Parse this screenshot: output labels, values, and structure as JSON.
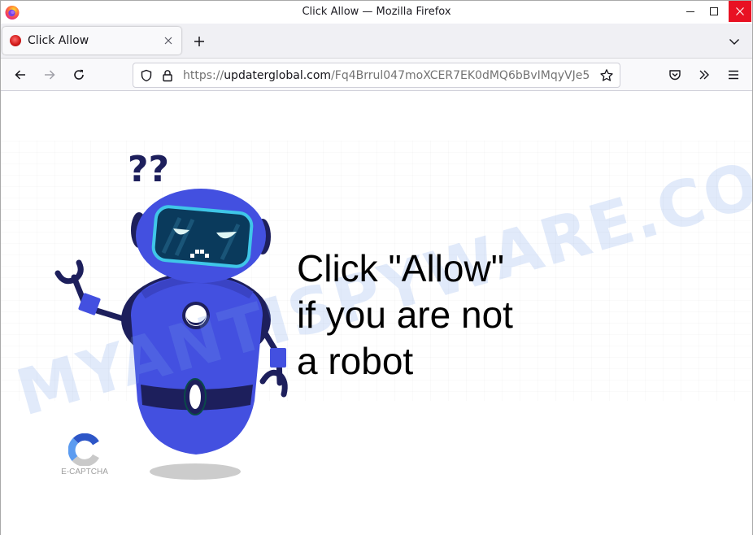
{
  "window": {
    "title": "Click Allow — Mozilla Firefox",
    "controls": {
      "minimize": "minimize",
      "maximize": "maximize",
      "close": "close"
    },
    "close_color": "#e81123"
  },
  "tabs": [
    {
      "label": "Click Allow",
      "active": true,
      "favicon": "red-circle-favicon"
    }
  ],
  "tabstrip": {
    "new_tab_icon": "plus-icon",
    "list_tabs_icon": "chevron-down-icon"
  },
  "navbar": {
    "back_icon": "arrow-left-icon",
    "forward_icon": "arrow-right-icon",
    "reload_icon": "reload-icon",
    "url": {
      "scheme": "https://",
      "host": "updaterglobal.com",
      "path": "/Fq4Brrul047moXCER7EK0dMQ6bBvIMqyVJe5"
    },
    "bookmark_icon": "star-icon",
    "pocket_icon": "pocket-icon",
    "overflow_icon": "double-chevron-right-icon",
    "menu_icon": "hamburger-menu-icon"
  },
  "page": {
    "message_lines": [
      "Click \"Allow\"",
      "if you are not",
      "a robot"
    ],
    "captcha_label": "E-CAPTCHA",
    "illustration": "confused-robot-illustration",
    "colors": {
      "robot_body": "#4350e0",
      "robot_dark": "#1d1f5c",
      "visor": "#0a3a5c",
      "visor_rim": "#3fc6e8",
      "shadow": "#cccccc"
    }
  },
  "watermark": "MYANTISPYWARE.COM"
}
